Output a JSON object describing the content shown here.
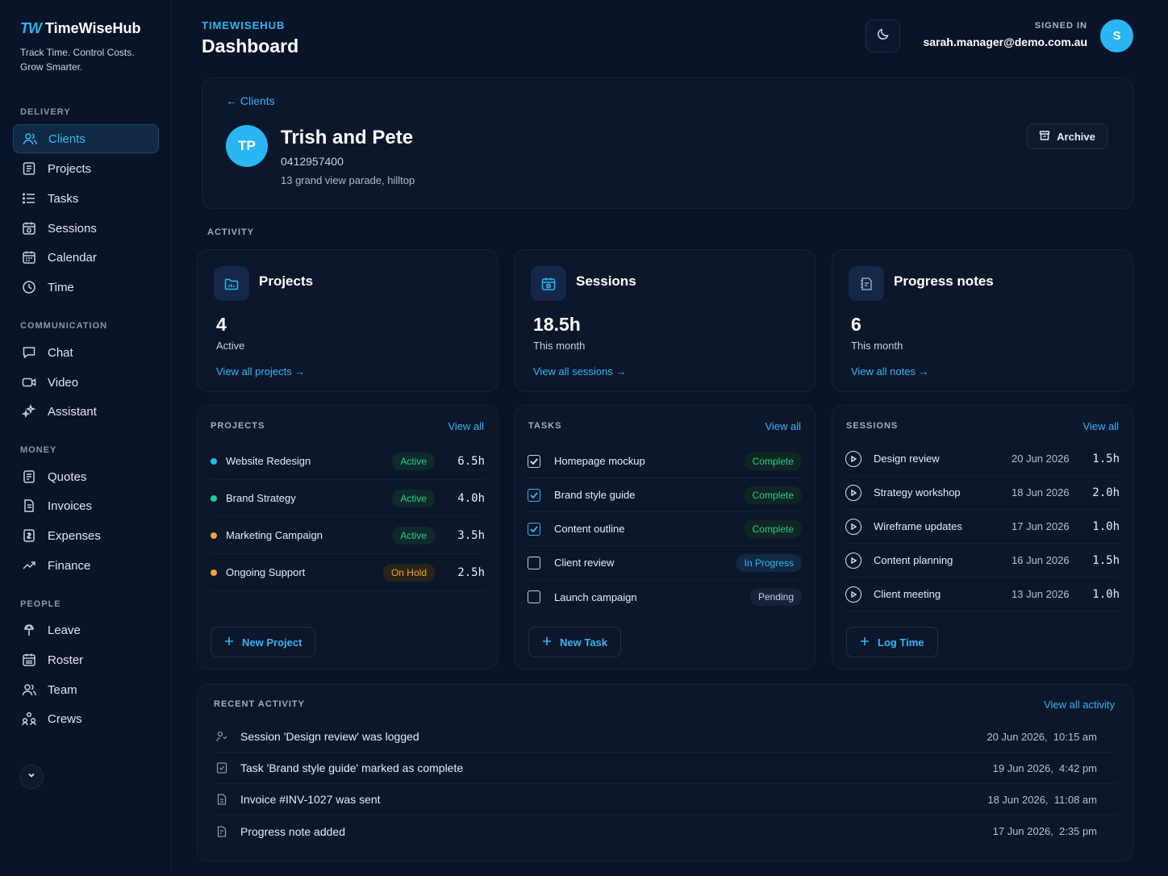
{
  "brand": {
    "mark": "TW",
    "name": "TimeWiseHub",
    "tagline": "Track Time. Control Costs. Grow Smarter."
  },
  "sidebar": {
    "sections": [
      {
        "label": "DELIVERY"
      },
      {
        "label": "COMMUNICATION"
      },
      {
        "label": "MONEY"
      },
      {
        "label": "PEOPLE"
      }
    ],
    "items": [
      {
        "label": "Clients",
        "icon": "users-icon"
      },
      {
        "label": "Projects",
        "icon": "projects-icon"
      },
      {
        "label": "Tasks",
        "icon": "tasks-icon"
      },
      {
        "label": "Sessions",
        "icon": "sessions-icon"
      },
      {
        "label": "Calendar",
        "icon": "calendar-icon"
      },
      {
        "label": "Time",
        "icon": "clock-icon"
      },
      {
        "label": "Chat",
        "icon": "chat-icon"
      },
      {
        "label": "Video",
        "icon": "video-icon"
      },
      {
        "label": "Assistant",
        "icon": "sparkle-icon"
      },
      {
        "label": "Quotes",
        "icon": "quotes-icon"
      },
      {
        "label": "Invoices",
        "icon": "invoice-icon"
      },
      {
        "label": "Expenses",
        "icon": "expenses-icon"
      },
      {
        "label": "Finance",
        "icon": "trend-icon"
      },
      {
        "label": "Leave",
        "icon": "leave-icon"
      },
      {
        "label": "Roster",
        "icon": "roster-icon"
      },
      {
        "label": "Team",
        "icon": "team-icon"
      },
      {
        "label": "Crews",
        "icon": "crews-icon"
      }
    ]
  },
  "header": {
    "kicker": "TIMEWISEHUB",
    "title": "Dashboard",
    "signed_in_label": "SIGNED IN",
    "email": "sarah.manager@demo.com.au",
    "avatar_initial": "S"
  },
  "client": {
    "back_label": "← Clients",
    "initials": "TP",
    "name": "Trish and Pete",
    "phone": "0412957400",
    "address": "13 grand view parade, hilltop",
    "archive_label": "Archive"
  },
  "activity_label": "ACTIVITY",
  "stats": [
    {
      "title": "Projects",
      "value": "4",
      "sub": "Active",
      "link": "View all projects →"
    },
    {
      "title": "Sessions",
      "value": "18.5h",
      "sub": "This month",
      "link": "View all sessions →"
    },
    {
      "title": "Progress notes",
      "value": "6",
      "sub": "This month",
      "link": "View all notes →"
    }
  ],
  "projects_panel": {
    "heading": "PROJECTS",
    "view_all": "View all",
    "rows": [
      {
        "name": "Website Redesign",
        "status": "Active",
        "hours": "6.5h",
        "dot": "#2bb5f0"
      },
      {
        "name": "Brand Strategy",
        "status": "Active",
        "hours": "4.0h",
        "dot": "#2fc98e"
      },
      {
        "name": "Marketing Campaign",
        "status": "Active",
        "hours": "3.5h",
        "dot": "#f0a53a"
      },
      {
        "name": "Ongoing Support",
        "status": "On Hold",
        "hours": "2.5h",
        "dot": "#f0a53a"
      }
    ],
    "button": "New Project"
  },
  "tasks_panel": {
    "heading": "TASKS",
    "view_all": "View all",
    "rows": [
      {
        "name": "Homepage mockup",
        "status": "Complete",
        "checked": true
      },
      {
        "name": "Brand style guide",
        "status": "Complete",
        "checked": true
      },
      {
        "name": "Content outline",
        "status": "Complete",
        "checked": true
      },
      {
        "name": "Client review",
        "status": "In Progress",
        "checked": false
      },
      {
        "name": "Launch campaign",
        "status": "Pending",
        "checked": false
      }
    ],
    "button": "New Task"
  },
  "sessions_panel": {
    "heading": "SESSIONS",
    "view_all": "View all",
    "rows": [
      {
        "name": "Design review",
        "date": "20 Jun 2026",
        "hours": "1.5h"
      },
      {
        "name": "Strategy workshop",
        "date": "18 Jun 2026",
        "hours": "2.0h"
      },
      {
        "name": "Wireframe updates",
        "date": "17 Jun 2026",
        "hours": "1.0h"
      },
      {
        "name": "Content planning",
        "date": "16 Jun 2026",
        "hours": "1.5h"
      },
      {
        "name": "Client meeting",
        "date": "13 Jun 2026",
        "hours": "1.0h"
      }
    ],
    "button": "Log Time"
  },
  "recent_activity": {
    "heading": "RECENT ACTIVITY",
    "view_all": "View all activity",
    "rows": [
      {
        "text": "Session 'Design review' was logged",
        "time": "20 Jun 2026,  10:15 am",
        "icon": "session-icon"
      },
      {
        "text": "Task 'Brand style guide' marked as complete",
        "time": "19 Jun 2026,  4:42 pm",
        "icon": "task-icon"
      },
      {
        "text": "Invoice #INV-1027  was sent",
        "time": "18 Jun 2026,  11:08 am",
        "icon": "invoice-icon"
      },
      {
        "text": "Progress note added",
        "time": "17 Jun 2026,  2:35 pm",
        "icon": "note-icon"
      }
    ]
  },
  "colors": {
    "accent": "#2bb5f0",
    "success": "#2fc98e",
    "warning": "#f0a53a",
    "background": "#0a1428"
  }
}
